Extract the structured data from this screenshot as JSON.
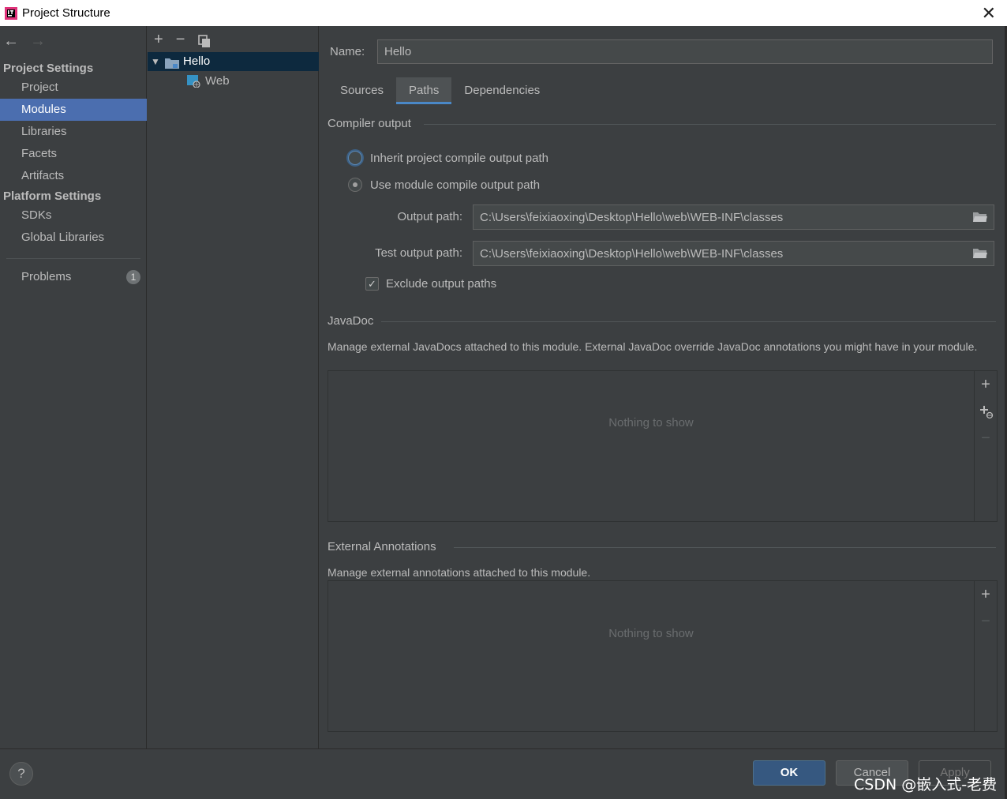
{
  "window": {
    "title": "Project Structure",
    "close_glyph": "✕"
  },
  "nav": {
    "back": "←",
    "forward": "→"
  },
  "sidebar": {
    "project_settings_header": "Project Settings",
    "platform_settings_header": "Platform Settings",
    "items": [
      {
        "label": "Project"
      },
      {
        "label": "Modules"
      },
      {
        "label": "Libraries"
      },
      {
        "label": "Facets"
      },
      {
        "label": "Artifacts"
      },
      {
        "label": "SDKs"
      },
      {
        "label": "Global Libraries"
      },
      {
        "label": "Problems"
      }
    ],
    "problems_count": "1",
    "selected": "Modules"
  },
  "tree": {
    "toolbar": {
      "add": "+",
      "remove": "−"
    },
    "caret": "▼",
    "root": "Hello",
    "child": "Web"
  },
  "main": {
    "name_label": "Name:",
    "name_value": "Hello",
    "tabs": [
      {
        "label": "Sources"
      },
      {
        "label": "Paths"
      },
      {
        "label": "Dependencies"
      }
    ],
    "active_tab": "Paths",
    "compiler_output": {
      "title": "Compiler output",
      "inherit_label": "Inherit project compile output path",
      "use_module_label": "Use module compile output path",
      "selected_option": "Use module compile output path",
      "output_path_label": "Output path:",
      "output_path_value": "C:\\Users\\feixiaoxing\\Desktop\\Hello\\web\\WEB-INF\\classes",
      "test_output_path_label": "Test output path:",
      "test_output_path_value": "C:\\Users\\feixiaoxing\\Desktop\\Hello\\web\\WEB-INF\\classes",
      "exclude_label": "Exclude output paths",
      "exclude_checked": true,
      "check_glyph": "✓"
    },
    "javadoc": {
      "title": "JavaDoc",
      "description": "Manage external JavaDocs attached to this module. External JavaDoc override JavaDoc annotations you might have in your module.",
      "empty_text": "Nothing to show",
      "tools": {
        "add": "+",
        "add_url": "+",
        "remove": "−"
      }
    },
    "external_annotations": {
      "title": "External Annotations",
      "description": "Manage external annotations attached to this module.",
      "empty_text": "Nothing to show",
      "tools": {
        "add": "+",
        "remove": "−"
      }
    }
  },
  "footer": {
    "help": "?",
    "ok": "OK",
    "cancel": "Cancel",
    "apply": "Apply",
    "watermark": "CSDN @嵌入式-老费"
  },
  "colors": {
    "background": "#3c3f41",
    "selection": "#4b6eaf",
    "tree_selection": "#0d293e",
    "tab_underline": "#4a88c7",
    "ok_button": "#365880"
  }
}
